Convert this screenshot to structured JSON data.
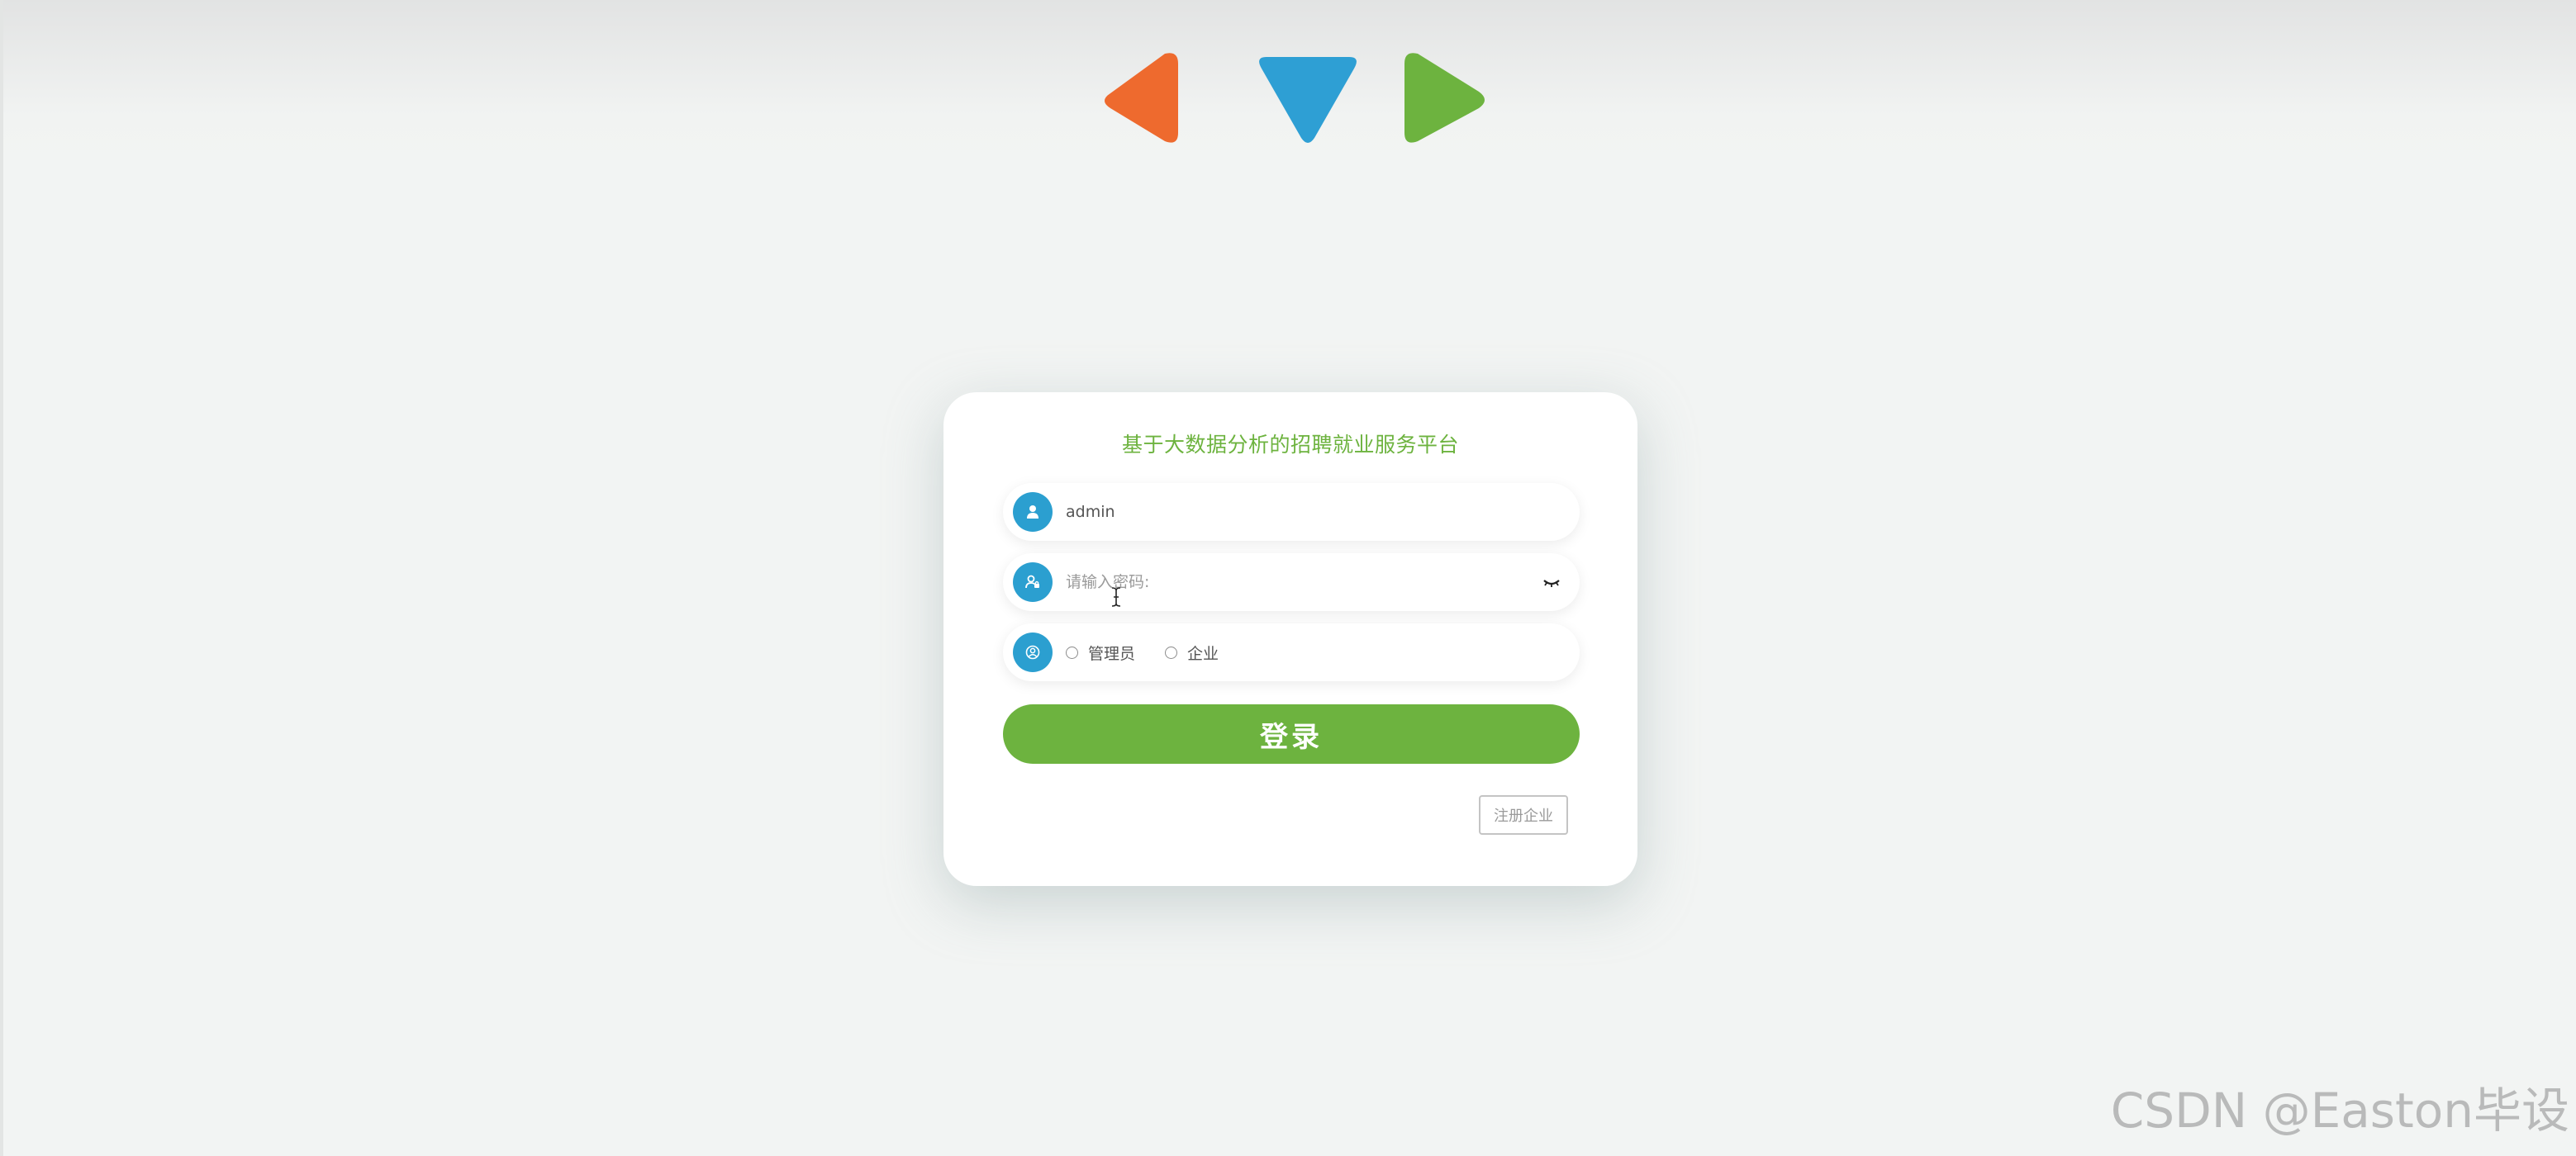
{
  "colors": {
    "accent_green": "#6db33f",
    "accent_blue": "#2b9fd0",
    "accent_orange": "#ee6a2e"
  },
  "header": {
    "decorations": [
      "left-triangle-icon",
      "down-triangle-icon",
      "right-triangle-icon"
    ]
  },
  "login_card": {
    "title": "基于大数据分析的招聘就业服务平台",
    "username": {
      "icon": "user-icon",
      "value": "admin"
    },
    "password": {
      "icon": "lock-user-icon",
      "placeholder": "请输入密码:",
      "toggle_icon": "eye-closed-icon"
    },
    "role": {
      "icon": "role-icon",
      "options": [
        "管理员",
        "企业"
      ]
    },
    "login_label": "登录",
    "register_label": "注册企业"
  },
  "watermark": "CSDN @Easton毕设"
}
